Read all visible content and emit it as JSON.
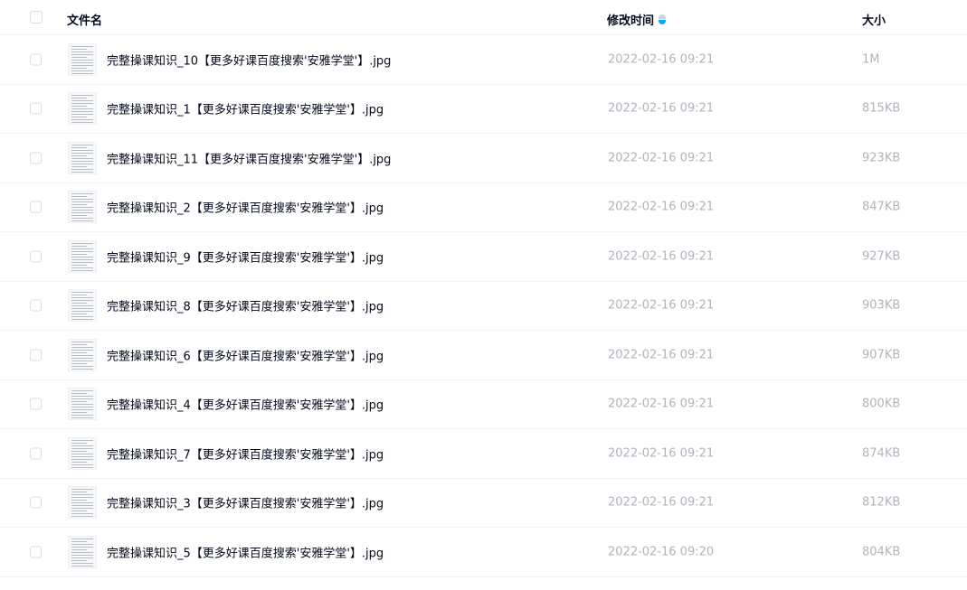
{
  "header": {
    "name_label": "文件名",
    "time_label": "修改时间",
    "size_label": "大小",
    "sort_icon": "sort-desc-icon",
    "sort_color": "#06a7ff"
  },
  "files": [
    {
      "name": "完整操课知识_10【更多好课百度搜索'安雅学堂'】.jpg",
      "time": "2022-02-16 09:21",
      "size": "1M"
    },
    {
      "name": "完整操课知识_1【更多好课百度搜索'安雅学堂'】.jpg",
      "time": "2022-02-16 09:21",
      "size": "815KB"
    },
    {
      "name": "完整操课知识_11【更多好课百度搜索'安雅学堂'】.jpg",
      "time": "2022-02-16 09:21",
      "size": "923KB"
    },
    {
      "name": "完整操课知识_2【更多好课百度搜索'安雅学堂'】.jpg",
      "time": "2022-02-16 09:21",
      "size": "847KB"
    },
    {
      "name": "完整操课知识_9【更多好课百度搜索'安雅学堂'】.jpg",
      "time": "2022-02-16 09:21",
      "size": "927KB"
    },
    {
      "name": "完整操课知识_8【更多好课百度搜索'安雅学堂'】.jpg",
      "time": "2022-02-16 09:21",
      "size": "903KB"
    },
    {
      "name": "完整操课知识_6【更多好课百度搜索'安雅学堂'】.jpg",
      "time": "2022-02-16 09:21",
      "size": "907KB"
    },
    {
      "name": "完整操课知识_4【更多好课百度搜索'安雅学堂'】.jpg",
      "time": "2022-02-16 09:21",
      "size": "800KB"
    },
    {
      "name": "完整操课知识_7【更多好课百度搜索'安雅学堂'】.jpg",
      "time": "2022-02-16 09:21",
      "size": "874KB"
    },
    {
      "name": "完整操课知识_3【更多好课百度搜索'安雅学堂'】.jpg",
      "time": "2022-02-16 09:21",
      "size": "812KB"
    },
    {
      "name": "完整操课知识_5【更多好课百度搜索'安雅学堂'】.jpg",
      "time": "2022-02-16 09:20",
      "size": "804KB"
    }
  ]
}
